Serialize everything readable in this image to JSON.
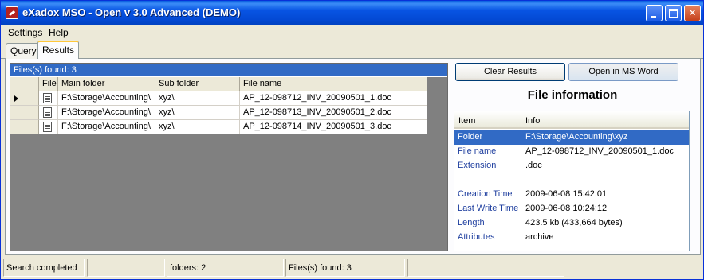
{
  "window": {
    "title": "eXadox MSO - Open v 3.0 Advanced (DEMO)"
  },
  "menu": {
    "settings": "Settings",
    "help": "Help"
  },
  "tabs": [
    {
      "label": "Query",
      "active": false
    },
    {
      "label": "Results",
      "active": true
    }
  ],
  "results": {
    "caption": "Files(s) found: 3",
    "columns": [
      "File",
      "Main folder",
      "Sub folder",
      "File name"
    ],
    "rows": [
      {
        "main_folder": "F:\\Storage\\Accounting\\",
        "sub_folder": "xyz\\",
        "file_name": "AP_12-098712_INV_20090501_1.doc",
        "selected": true
      },
      {
        "main_folder": "F:\\Storage\\Accounting\\",
        "sub_folder": "xyz\\",
        "file_name": "AP_12-098713_INV_20090501_2.doc",
        "selected": false
      },
      {
        "main_folder": "F:\\Storage\\Accounting\\",
        "sub_folder": "xyz\\",
        "file_name": "AP_12-098714_INV_20090501_3.doc",
        "selected": false
      }
    ]
  },
  "buttons": {
    "clear_results": "Clear Results",
    "open_in_word": "Open in MS Word"
  },
  "file_info": {
    "title": "File information",
    "columns": [
      "Item",
      "Info"
    ],
    "rows": [
      {
        "item": "Folder",
        "info": "F:\\Storage\\Accounting\\xyz",
        "selected": true
      },
      {
        "item": "File name",
        "info": "AP_12-098712_INV_20090501_1.doc"
      },
      {
        "item": "Extension",
        "info": ".doc"
      },
      {
        "item": "",
        "info": ""
      },
      {
        "item": "Creation Time",
        "info": "2009-06-08 15:42:01"
      },
      {
        "item": "Last Write Time",
        "info": "2009-06-08 10:24:12"
      },
      {
        "item": "Length",
        "info": "423.5 kb (433,664 bytes)"
      },
      {
        "item": "Attributes",
        "info": "archive"
      }
    ]
  },
  "status": {
    "message": "Search completed",
    "panel2": "",
    "folders": "folders: 2",
    "files": "Files(s) found: 3",
    "panel5": ""
  },
  "colors": {
    "title_bar": "#0854e3",
    "selection": "#316ac5",
    "grid_background": "#808080"
  }
}
